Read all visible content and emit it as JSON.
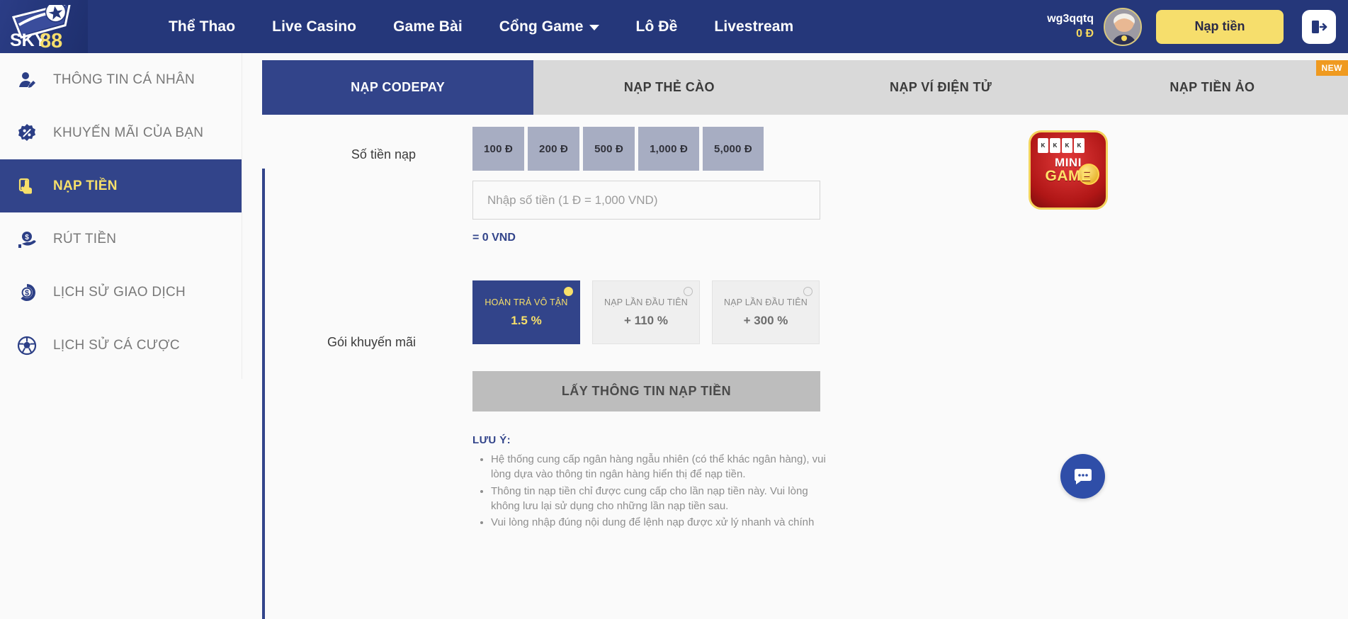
{
  "header": {
    "logo_text_top": "SKY",
    "logo_text_num": "88",
    "nav": [
      {
        "label": "Thể Thao",
        "caret": false
      },
      {
        "label": "Live Casino",
        "caret": false
      },
      {
        "label": "Game Bài",
        "caret": false
      },
      {
        "label": "Cổng Game",
        "caret": true
      },
      {
        "label": "Lô Đề",
        "caret": false
      },
      {
        "label": "Livestream",
        "caret": false
      }
    ],
    "user_name": "wg3qqtq",
    "user_balance": "0 Đ",
    "deposit_button": "Nạp tiền",
    "logout_icon": "logout-icon",
    "avatar_icon": "avatar"
  },
  "sidebar": {
    "items": [
      {
        "label": "THÔNG TIN CÁ NHÂN",
        "icon": "user-edit-icon",
        "active": false
      },
      {
        "label": "KHUYẾN MÃI CỦA BẠN",
        "icon": "percent-badge-icon",
        "active": false
      },
      {
        "label": "NẠP TIỀN",
        "icon": "hand-card-icon",
        "active": true
      },
      {
        "label": "RÚT TIỀN",
        "icon": "hand-coin-icon",
        "active": false
      },
      {
        "label": "LỊCH SỬ GIAO DỊCH",
        "icon": "coin-history-icon",
        "active": false
      },
      {
        "label": "LỊCH SỬ CÁ CƯỢC",
        "icon": "ball-icon",
        "active": false
      }
    ]
  },
  "tabs": [
    {
      "label": "NẠP CODEPAY",
      "active": true,
      "badge": ""
    },
    {
      "label": "NẠP THẺ CÀO",
      "active": false,
      "badge": ""
    },
    {
      "label": "NẠP VÍ ĐIỆN TỬ",
      "active": false,
      "badge": ""
    },
    {
      "label": "NẠP TIỀN ẢO",
      "active": false,
      "badge": "NEW"
    }
  ],
  "form": {
    "amount_label": "Số tiền nạp",
    "amount_chips": [
      "100 Đ",
      "200 Đ",
      "500 Đ",
      "1,000 Đ",
      "5,000 Đ"
    ],
    "amount_placeholder": "Nhập số tiền (1 Đ = 1,000 VND)",
    "amount_value": "",
    "converted": "= 0 VND",
    "promo_label": "Gói khuyến mãi",
    "promos": [
      {
        "title": "HOÀN TRẢ VÔ TẬN",
        "value": "1.5 %",
        "selected": true
      },
      {
        "title": "NẠP LẦN ĐẦU TIÊN",
        "value": "+ 110 %",
        "selected": false
      },
      {
        "title": "NẠP LẦN ĐẦU TIÊN",
        "value": "+ 300 %",
        "selected": false
      }
    ],
    "submit_label": "LẤY THÔNG TIN NẠP TIỀN"
  },
  "notes": {
    "title": "LƯU Ý:",
    "items": [
      "Hệ thống cung cấp ngân hàng ngẫu nhiên (có thể khác ngân hàng), vui lòng dựa vào thông tin ngân hàng hiển thị để nạp tiền.",
      "Thông tin nạp tiền chỉ được cung cấp cho lần nạp tiền này. Vui lòng không lưu lại sử dụng cho những lần nạp tiền sau.",
      "Vui lòng nhập đúng nội dung để lệnh nạp được xử lý nhanh và chính"
    ]
  },
  "minigame": {
    "line1": "MINI",
    "line2": "GAME",
    "cards": [
      "K",
      "K",
      "K",
      "K"
    ]
  },
  "chat": {
    "icon": "chat-icon"
  },
  "colors": {
    "brand_navy": "#25377a",
    "accent_navy": "#32448a",
    "accent_yellow": "#f6de6c",
    "badge_orange": "#ef9a20",
    "chip_gray": "#a7adc2",
    "tabbar_gray": "#d9d9d9"
  }
}
